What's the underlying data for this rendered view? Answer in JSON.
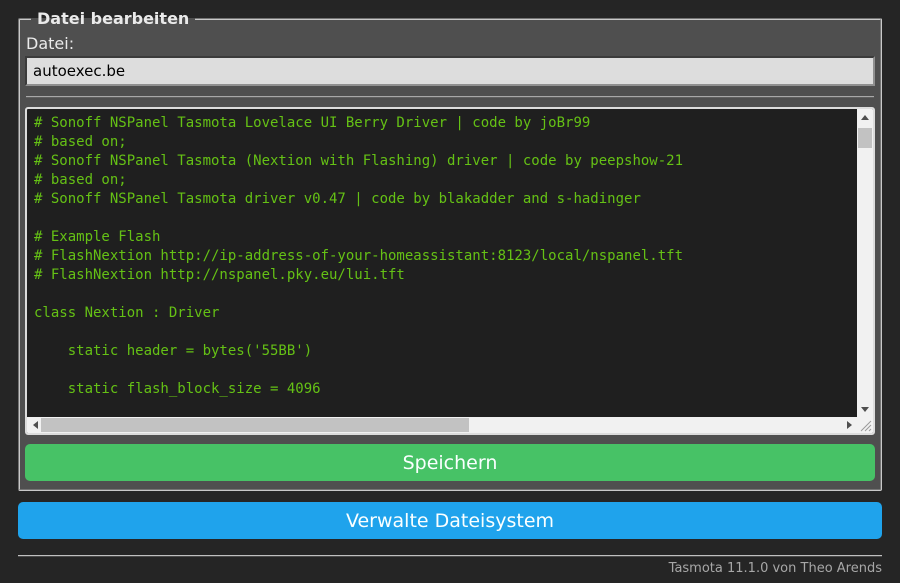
{
  "editor": {
    "legend": "Datei bearbeiten",
    "file_label": "Datei:",
    "file_value": "autoexec.be",
    "content": "# Sonoff NSPanel Tasmota Lovelace UI Berry Driver | code by joBr99\n# based on;\n# Sonoff NSPanel Tasmota (Nextion with Flashing) driver | code by peepshow-21\n# based on;\n# Sonoff NSPanel Tasmota driver v0.47 | code by blakadder and s-hadinger\n\n# Example Flash\n# FlashNextion http://ip-address-of-your-homeassistant:8123/local/nspanel.tft\n# FlashNextion http://nspanel.pky.eu/lui.tft\n\nclass Nextion : Driver\n\n    static header = bytes('55BB')\n\n    static flash_block_size = 4096",
    "save_button_label": "Speichern"
  },
  "filesystem": {
    "manage_button_label": "Verwalte Dateisystem"
  },
  "footer": {
    "version": "Tasmota 11.1.0",
    "credit": " von Theo Arends"
  },
  "colors": {
    "page_background": "#252525",
    "form_background": "#4f4f4f",
    "text": "#eaeaea",
    "input_background": "#dddddd",
    "input_text": "#000000",
    "console_background": "#1f1f1f",
    "console_text": "#65c115",
    "save_button": "#47c266",
    "action_button": "#1fa3ec",
    "button_text": "#faffff",
    "footer_text": "#a7a7a7"
  }
}
